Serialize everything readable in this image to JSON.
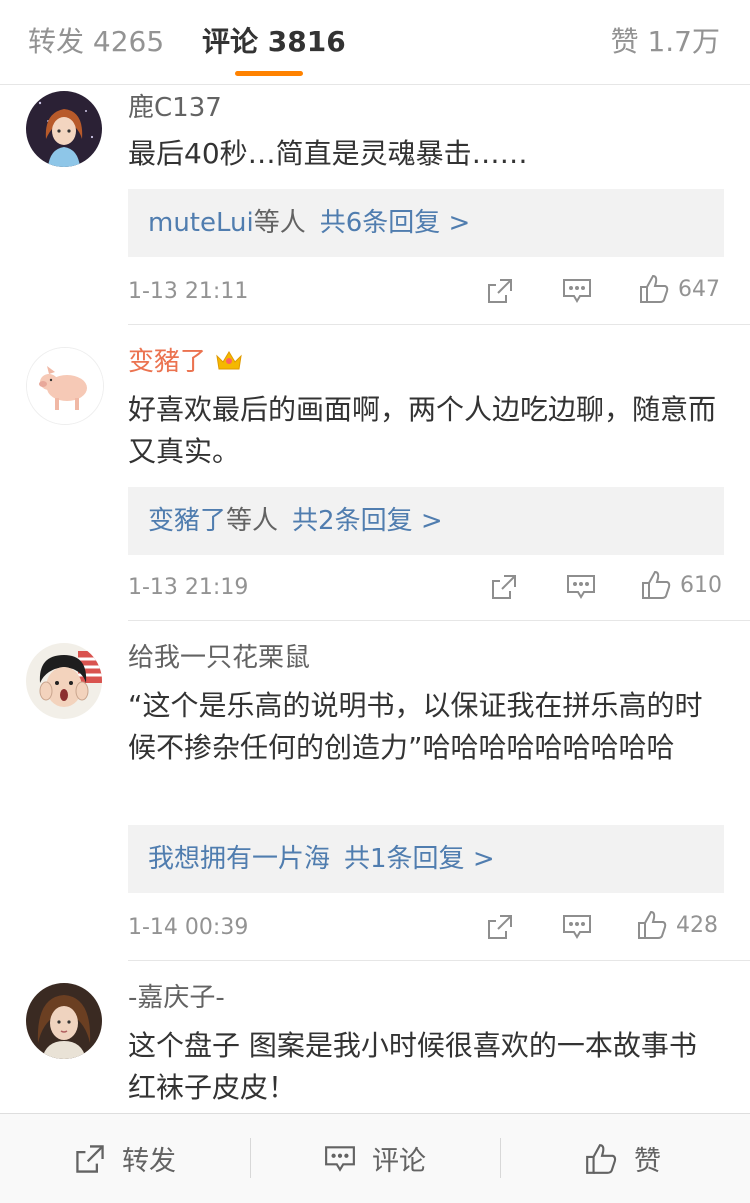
{
  "tabs": {
    "repost": "转发 4265",
    "comments": "评论 3816",
    "likes": "赞 1.7万"
  },
  "comments": [
    {
      "username": "鹿C137",
      "text": "最后40秒…简直是灵魂暴击……",
      "reply_who": "muteLui",
      "reply_suffix": "等人",
      "reply_count": "共6条回复 >",
      "time": "1-13 21:11",
      "likes": "647"
    },
    {
      "username": "变豬了",
      "text": "好喜欢最后的画面啊，两个人边吃边聊，随意而又真实。",
      "reply_who": "变豬了",
      "reply_suffix": "等人",
      "reply_count": "共2条回复 >",
      "time": "1-13 21:19",
      "likes": "610"
    },
    {
      "username": "给我一只花栗鼠",
      "text": "“这个是乐高的说明书，以保证我在拼乐高的时候不掺杂任何的创造力”哈哈哈哈哈哈哈哈哈",
      "reply_who": "我想拥有一片海",
      "reply_suffix": "",
      "reply_count": "共1条回复 >",
      "time": "1-14 00:39",
      "likes": "428"
    },
    {
      "username": "-嘉庆子-",
      "text": "这个盘子 图案是我小时候很喜欢的一本故事书 红袜子皮皮！"
    }
  ],
  "bottom_bar": {
    "repost": "转发",
    "comment": "评论",
    "like": "赞"
  },
  "colors": {
    "accent": "#ff8200",
    "link": "#507daf",
    "vip_name": "#eb7350",
    "muted": "#939393"
  }
}
